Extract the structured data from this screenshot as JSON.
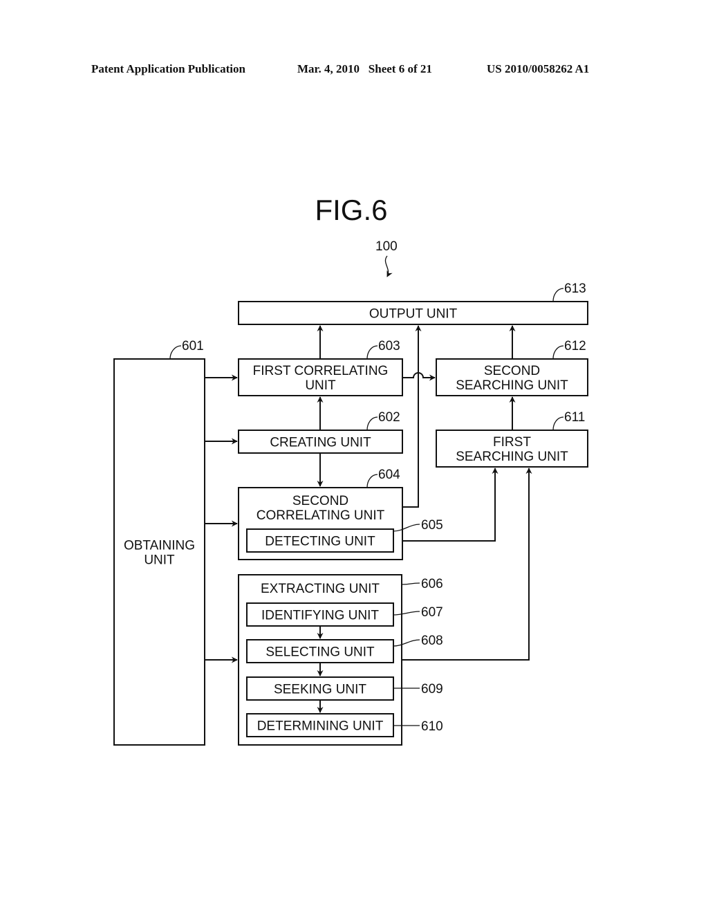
{
  "header": {
    "publication": "Patent Application Publication",
    "date_sheet": "Mar. 4, 2010   Sheet 6 of 21",
    "patent_number": "US 2010/0058262 A1"
  },
  "figure": {
    "title": "FIG.6",
    "system_ref": "100"
  },
  "units": {
    "output": {
      "ref": "613",
      "lines": [
        "OUTPUT UNIT"
      ]
    },
    "obtaining": {
      "ref": "601",
      "lines": [
        "OBTAINING",
        "UNIT"
      ]
    },
    "first_corr": {
      "ref": "603",
      "lines": [
        "FIRST CORRELATING",
        "UNIT"
      ]
    },
    "creating": {
      "ref": "602",
      "lines": [
        "CREATING UNIT"
      ]
    },
    "second_corr": {
      "ref": "604",
      "lines": [
        "SECOND",
        "CORRELATING UNIT"
      ]
    },
    "detecting": {
      "ref": "605",
      "lines": [
        "DETECTING UNIT"
      ]
    },
    "extracting": {
      "ref": "606",
      "lines": [
        "EXTRACTING UNIT"
      ]
    },
    "identifying": {
      "ref": "607",
      "lines": [
        "IDENTIFYING UNIT"
      ]
    },
    "selecting": {
      "ref": "608",
      "lines": [
        "SELECTING UNIT"
      ]
    },
    "seeking": {
      "ref": "609",
      "lines": [
        "SEEKING UNIT"
      ]
    },
    "determining": {
      "ref": "610",
      "lines": [
        "DETERMINING UNIT"
      ]
    },
    "first_search": {
      "ref": "611",
      "lines": [
        "FIRST",
        "SEARCHING UNIT"
      ]
    },
    "second_search": {
      "ref": "612",
      "lines": [
        "SECOND",
        "SEARCHING UNIT"
      ]
    }
  },
  "connections": [
    {
      "from": "obtaining",
      "to": "first_corr"
    },
    {
      "from": "obtaining",
      "to": "creating"
    },
    {
      "from": "obtaining",
      "to": "second_corr"
    },
    {
      "from": "obtaining",
      "to": "extracting"
    },
    {
      "from": "creating",
      "to": "first_corr"
    },
    {
      "from": "creating",
      "to": "second_corr"
    },
    {
      "from": "first_corr",
      "to": "output"
    },
    {
      "from": "first_corr",
      "to": "second_search"
    },
    {
      "from": "second_corr",
      "to": "output"
    },
    {
      "from": "detecting",
      "to": "first_search"
    },
    {
      "from": "selecting",
      "to": "first_search"
    },
    {
      "from": "first_search",
      "to": "second_search"
    },
    {
      "from": "second_search",
      "to": "output"
    },
    {
      "from": "identifying",
      "to": "selecting"
    },
    {
      "from": "selecting",
      "to": "seeking"
    },
    {
      "from": "seeking",
      "to": "determining"
    }
  ]
}
